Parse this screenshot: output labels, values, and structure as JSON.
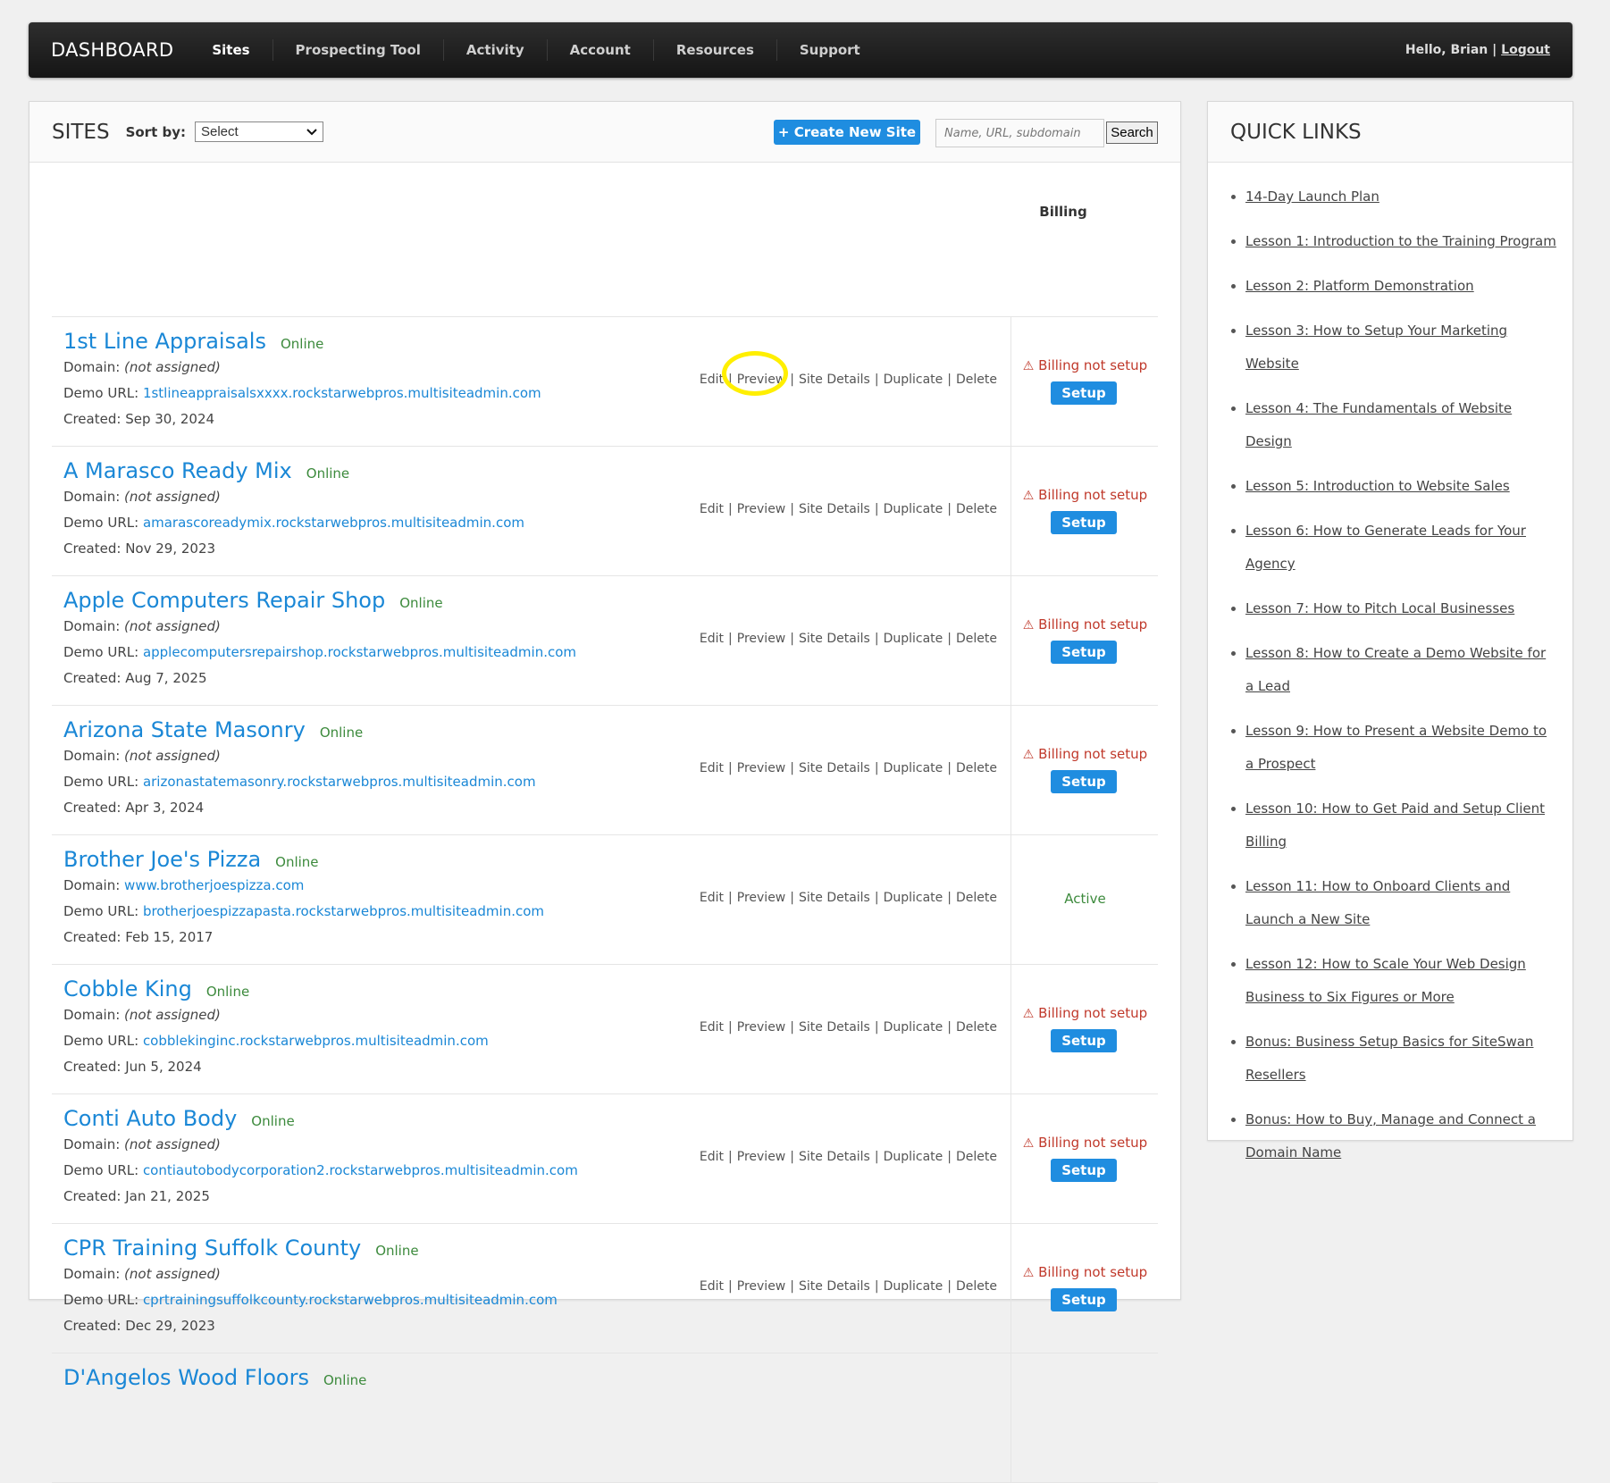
{
  "nav": {
    "brand": "DASHBOARD",
    "items": [
      "Sites",
      "Prospecting Tool",
      "Activity",
      "Account",
      "Resources",
      "Support"
    ],
    "greeting": "Hello, Brian",
    "separator": "|",
    "logout": "Logout"
  },
  "sites_panel": {
    "title": "SITES",
    "sort_label": "Sort by:",
    "sort_value": "Select",
    "create_button": "+ Create New Site",
    "search_placeholder": "Name, URL, subdomain",
    "search_button": "Search",
    "billing_header": "Billing"
  },
  "labels": {
    "domain": "Domain:",
    "demo_url": "Demo URL:",
    "created": "Created:",
    "not_assigned": "(not assigned)",
    "actions": [
      "Edit",
      "Preview",
      "Site Details",
      "Duplicate",
      "Delete"
    ],
    "billing_not_setup": "Billing not setup",
    "setup": "Setup",
    "active": "Active"
  },
  "sites": [
    {
      "name": "1st Line Appraisals",
      "status": "Online",
      "domain": "",
      "demo_url": "1stlineappraisalsxxxx.rockstarwebpros.multisiteadmin.com",
      "created": "Sep 30, 2024",
      "billing": "not_setup"
    },
    {
      "name": "A Marasco Ready Mix",
      "status": "Online",
      "domain": "",
      "demo_url": "amarascoreadymix.rockstarwebpros.multisiteadmin.com",
      "created": "Nov 29, 2023",
      "billing": "not_setup"
    },
    {
      "name": "Apple Computers Repair Shop",
      "status": "Online",
      "domain": "",
      "demo_url": "applecomputersrepairshop.rockstarwebpros.multisiteadmin.com",
      "created": "Aug 7, 2025",
      "billing": "not_setup"
    },
    {
      "name": "Arizona State Masonry",
      "status": "Online",
      "domain": "",
      "demo_url": "arizonastatemasonry.rockstarwebpros.multisiteadmin.com",
      "created": "Apr 3, 2024",
      "billing": "not_setup"
    },
    {
      "name": "Brother Joe's Pizza",
      "status": "Online",
      "domain": "www.brotherjoespizza.com",
      "demo_url": "brotherjoespizzapasta.rockstarwebpros.multisiteadmin.com",
      "created": "Feb 15, 2017",
      "billing": "active"
    },
    {
      "name": "Cobble King",
      "status": "Online",
      "domain": "",
      "demo_url": "cobblekinginc.rockstarwebpros.multisiteadmin.com",
      "created": "Jun 5, 2024",
      "billing": "not_setup"
    },
    {
      "name": "Conti Auto Body",
      "status": "Online",
      "domain": "",
      "demo_url": "contiautobodycorporation2.rockstarwebpros.multisiteadmin.com",
      "created": "Jan 21, 2025",
      "billing": "not_setup"
    },
    {
      "name": "CPR Training Suffolk County",
      "status": "Online",
      "domain": "",
      "demo_url": "cprtrainingsuffolkcounty.rockstarwebpros.multisiteadmin.com",
      "created": "Dec 29, 2023",
      "billing": "not_setup"
    },
    {
      "name": "D'Angelos Wood Floors",
      "status": "Online",
      "domain": "",
      "demo_url": "",
      "created": "",
      "billing": ""
    }
  ],
  "quick_links": {
    "title": "QUICK LINKS",
    "items": [
      "14-Day Launch Plan",
      "Lesson 1: Introduction to the Training Program",
      "Lesson 2: Platform Demonstration",
      "Lesson 3: How to Setup Your Marketing Website",
      "Lesson 4: The Fundamentals of Website Design",
      "Lesson 5: Introduction to Website Sales",
      "Lesson 6: How to Generate Leads for Your Agency",
      "Lesson 7: How to Pitch Local Businesses",
      "Lesson 8: How to Create a Demo Website for a Lead",
      "Lesson 9: How to Present a Website Demo to a Prospect",
      "Lesson 10: How to Get Paid and Setup Client Billing",
      "Lesson 11: How to Onboard Clients and Launch a New Site",
      "Lesson 12: How to Scale Your Web Design Business to Six Figures or More",
      "Bonus: Business Setup Basics for SiteSwan Resellers",
      "Bonus: How to Buy, Manage and Connect a Domain Name"
    ]
  },
  "colors": {
    "accent": "#1f8de0",
    "link": "#1a87d6",
    "online": "#3c8a3c",
    "warning": "#c0392b",
    "highlight": "#ffef00"
  }
}
